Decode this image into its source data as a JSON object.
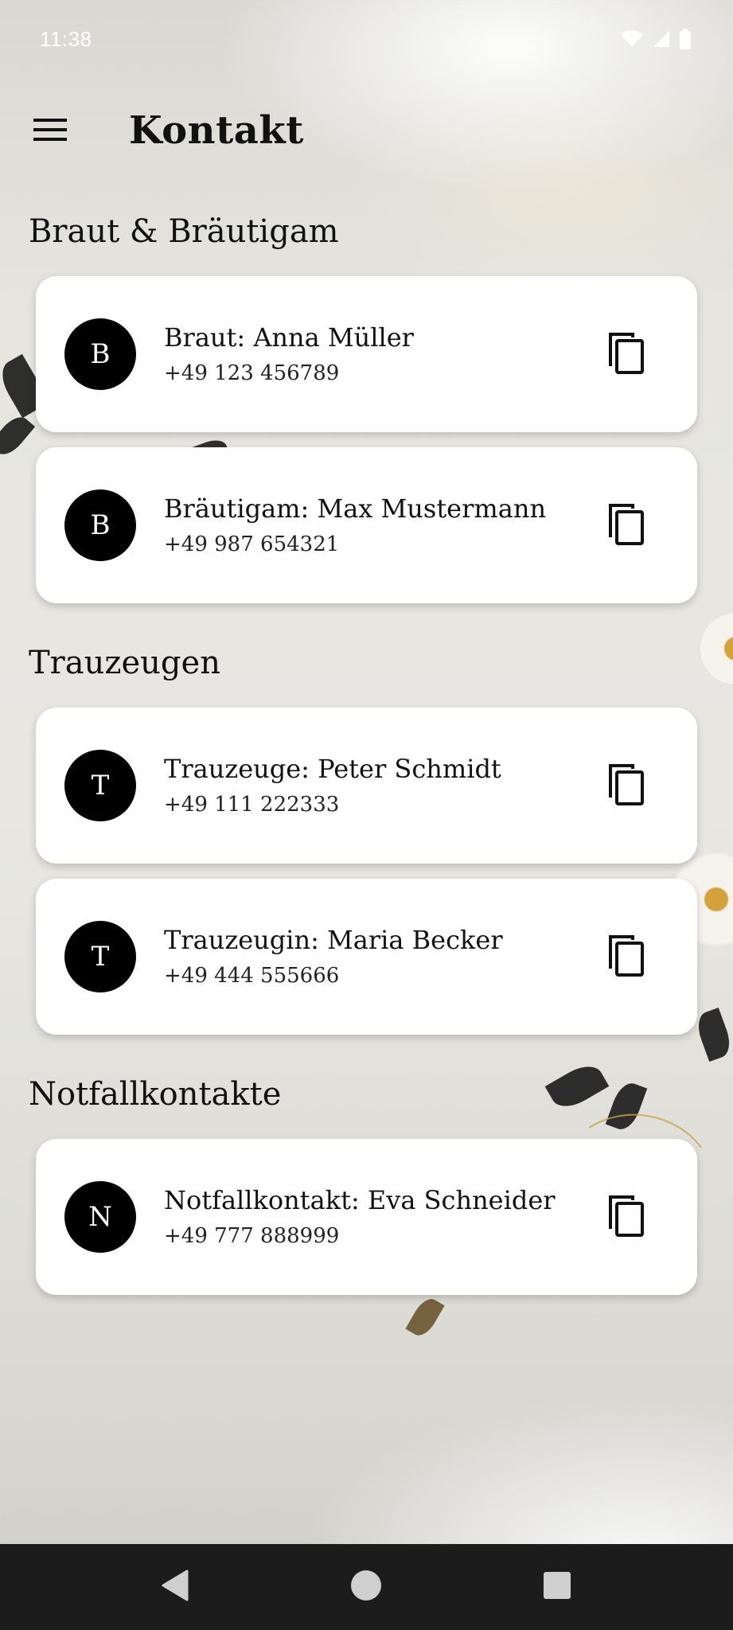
{
  "status_bar": {
    "time": "11:38",
    "icons": [
      "wifi-icon",
      "signal-icon",
      "battery-icon"
    ]
  },
  "app_bar": {
    "menu_icon": "menu-icon",
    "title": "Kontakt"
  },
  "sections": [
    {
      "title": "Braut & Bräutigam",
      "contacts": [
        {
          "initial": "B",
          "name": "Braut: Anna Müller",
          "phone": "+49 123 456789"
        },
        {
          "initial": "B",
          "name": "Bräutigam: Max Mustermann",
          "phone": "+49 987 654321"
        }
      ]
    },
    {
      "title": "Trauzeugen",
      "contacts": [
        {
          "initial": "T",
          "name": "Trauzeuge: Peter Schmidt",
          "phone": "+49 111 222333"
        },
        {
          "initial": "T",
          "name": "Trauzeugin: Maria Becker",
          "phone": "+49 444 555666"
        }
      ]
    },
    {
      "title": "Notfallkontakte",
      "contacts": [
        {
          "initial": "N",
          "name": "Notfallkontakt: Eva Schneider",
          "phone": "+49 777 888999"
        }
      ]
    }
  ],
  "nav_bar": {
    "icons": [
      "back-icon",
      "home-icon",
      "recents-icon"
    ]
  },
  "colors": {
    "avatar_bg": "#000000",
    "card_bg": "#ffffff",
    "nav_bar_bg": "#1c1c1c"
  }
}
